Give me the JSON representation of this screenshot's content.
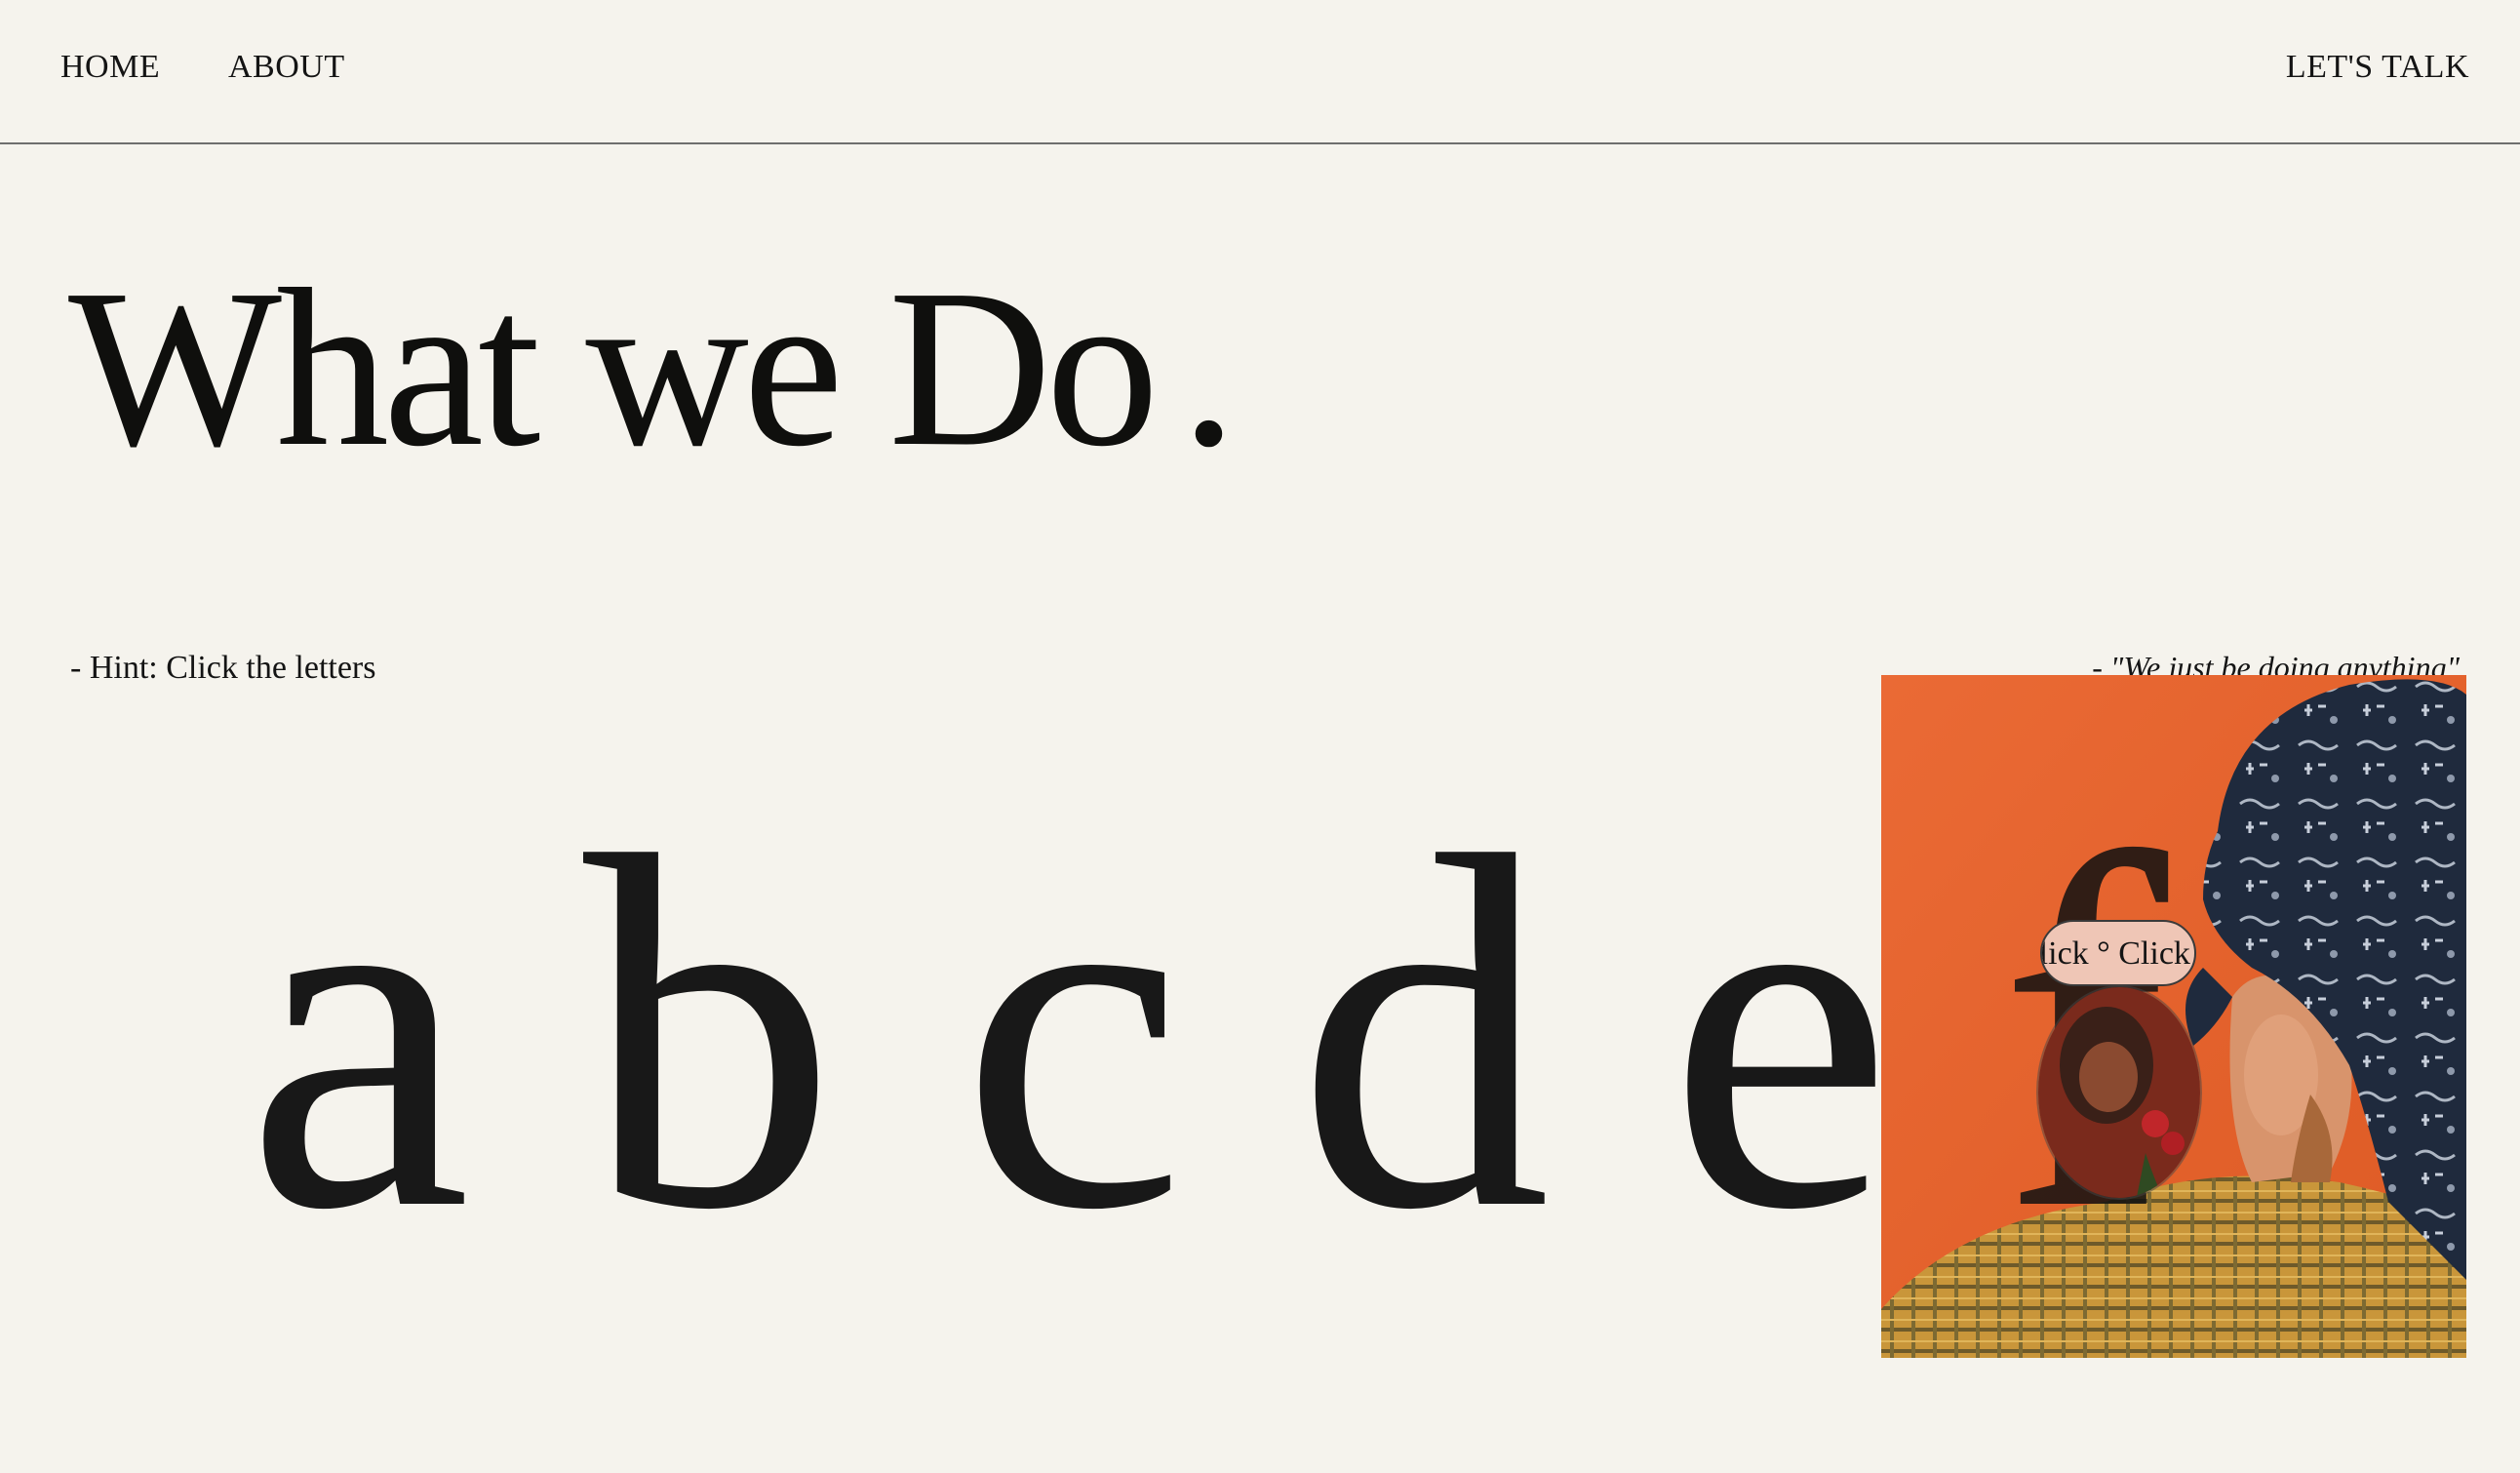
{
  "nav": {
    "home": "HOME",
    "about": "ABOUT",
    "cta": "LET'S TALK"
  },
  "hero": {
    "title": "What we Do",
    "title_dot": "."
  },
  "hints": {
    "left": "- Hint: Click the letters",
    "right": "- \"We just be doing anything\""
  },
  "letters": [
    "a",
    "b",
    "c",
    "d",
    "e",
    "f"
  ],
  "cursor": {
    "label": "Click ° Click °"
  },
  "colors": {
    "background": "#f5f3ed",
    "text": "#141414",
    "photo_orange": "#e8622c",
    "pill": "#efc6b6"
  },
  "icons": {
    "photo": "portrait-photo",
    "lens": "magnifier-lens"
  }
}
